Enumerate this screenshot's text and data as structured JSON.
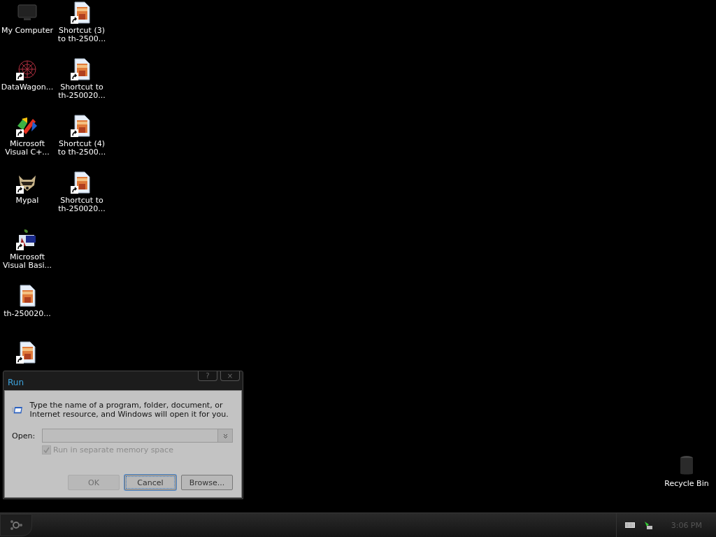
{
  "desktop_icons": [
    {
      "label": "My Computer",
      "kind": "monitor",
      "shortcut": false
    },
    {
      "label": "DataWagon...",
      "kind": "web",
      "shortcut": true
    },
    {
      "label": "Microsoft Visual C+...",
      "kind": "vcpp",
      "shortcut": true
    },
    {
      "label": "Mypal",
      "kind": "raccoon",
      "shortcut": true
    },
    {
      "label": "Microsoft Visual Basi...",
      "kind": "vb",
      "shortcut": true
    },
    {
      "label": "th-250020...",
      "kind": "image",
      "shortcut": false
    },
    {
      "kind": "image",
      "shortcut": true
    },
    {
      "label": "Shortcut (3) to th-2500...",
      "kind": "image",
      "shortcut": true
    },
    {
      "label": "Shortcut to th-250020...",
      "kind": "image",
      "shortcut": true
    },
    {
      "label": "Shortcut (4) to th-2500...",
      "kind": "image",
      "shortcut": true
    },
    {
      "label": "Shortcut to th-250020...",
      "kind": "image",
      "shortcut": true
    }
  ],
  "recycle_bin": {
    "label": "Recycle Bin"
  },
  "dialog": {
    "title": "Run",
    "help": "?",
    "close": "×",
    "description": "Type the name of a program, folder, document, or Internet resource, and Windows will open it for you.",
    "open_label": "Open:",
    "memory_checkbox": {
      "label": "Run in separate memory space",
      "checked": true,
      "disabled": true
    },
    "buttons": [
      {
        "label": "OK",
        "disabled": true,
        "focused": false
      },
      {
        "label": "Cancel",
        "disabled": false,
        "focused": true
      },
      {
        "label": "Browse...",
        "disabled": false,
        "focused": false
      }
    ]
  },
  "taskbar": {
    "clock": "3:06 PM"
  }
}
